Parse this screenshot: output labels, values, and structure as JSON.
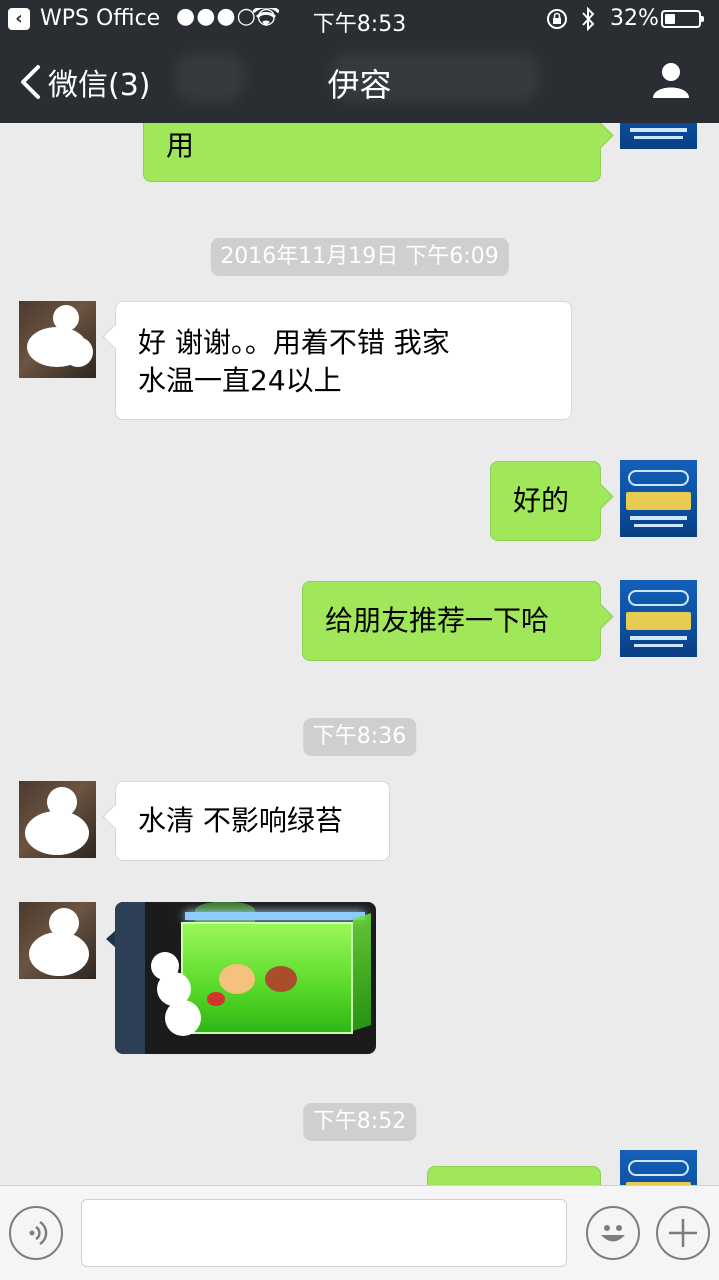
{
  "status_bar": {
    "app_name": "WPS Office",
    "signal": "●●●○○",
    "time": "下午8:53",
    "battery_percent": "32%",
    "battery_level": 0.32
  },
  "nav": {
    "back_label": "微信(3)",
    "title": "伊容"
  },
  "messages": [
    {
      "from": "me",
      "type": "text",
      "text": "用"
    },
    {
      "type": "time",
      "text": "2016年11月19日 下午6:09"
    },
    {
      "from": "friend",
      "type": "text",
      "lines": [
        "好  谢谢。。用着不错  我家",
        "水温一直24以上"
      ]
    },
    {
      "from": "me",
      "type": "text",
      "text": "好的"
    },
    {
      "from": "me",
      "type": "text",
      "text": "给朋友推荐一下哈"
    },
    {
      "type": "time",
      "text": "下午8:36"
    },
    {
      "from": "friend",
      "type": "text",
      "text": "水清 不影响绿苔"
    },
    {
      "from": "friend",
      "type": "image",
      "subject": "aquarium-photo"
    },
    {
      "type": "time",
      "text": "下午8:52"
    },
    {
      "from": "me",
      "type": "text",
      "text": ""
    }
  ],
  "colors": {
    "nav_bg": "#2a2d32",
    "chat_bg": "#ebebeb",
    "my_bubble": "#a0e75a",
    "friend_bubble": "#ffffff",
    "time_chip": "#cfcfcf"
  },
  "input_bar": {
    "value": "",
    "icons": [
      "voice-icon",
      "emoji-icon",
      "plus-icon"
    ]
  }
}
